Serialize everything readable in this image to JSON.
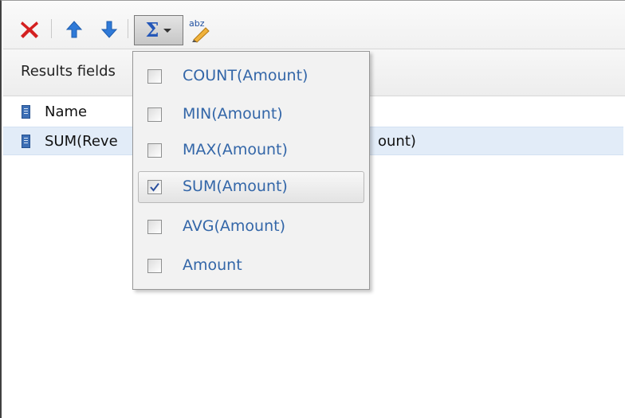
{
  "toolbar": {
    "icons": [
      "delete-icon",
      "move-up-icon",
      "move-down-icon",
      "sigma-icon",
      "chevron-down-icon",
      "rename-icon"
    ],
    "rename_icon_text": "abz",
    "sigma_symbol": "Σ"
  },
  "results": {
    "header_label": "Results fields",
    "rows": [
      {
        "label": "Name",
        "tail": "",
        "selected": false
      },
      {
        "label": "SUM(Reve",
        "tail": "ount)",
        "selected": true
      }
    ]
  },
  "aggregate_menu": {
    "items": [
      {
        "label": "COUNT(Amount)",
        "checked": false,
        "hover": false
      },
      {
        "label": "MIN(Amount)",
        "checked": false,
        "hover": false
      },
      {
        "label": "MAX(Amount)",
        "checked": false,
        "hover": false
      },
      {
        "label": "SUM(Amount)",
        "checked": true,
        "hover": true
      },
      {
        "label": "AVG(Amount)",
        "checked": false,
        "hover": false
      },
      {
        "label": "Amount",
        "checked": false,
        "hover": false
      }
    ]
  },
  "colors": {
    "delete_red": "#d42020",
    "arrow_blue": "#2f7ad8",
    "menu_text": "#3366a8",
    "selection": "#e2ecf8"
  }
}
